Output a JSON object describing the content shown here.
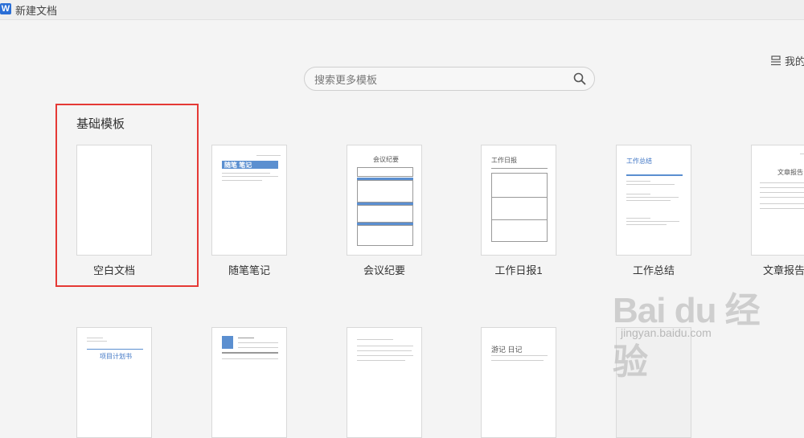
{
  "window": {
    "title": "新建文档",
    "app_icon_letter": "W"
  },
  "search": {
    "placeholder": "搜索更多模板",
    "value": ""
  },
  "my_templates": {
    "label": "我的"
  },
  "section": {
    "title": "基础模板"
  },
  "templates": [
    {
      "label": "空白文档",
      "highlighted": true
    },
    {
      "label": "随笔笔记",
      "thumb_title": "随笔 笔记"
    },
    {
      "label": "会议纪要",
      "thumb_title": "会议纪要"
    },
    {
      "label": "工作日报1",
      "thumb_title": "工作日报"
    },
    {
      "label": "工作总结",
      "thumb_title": "工作总结"
    },
    {
      "label": "文章报告",
      "thumb_title": "文章报告"
    }
  ],
  "row2": [
    {
      "thumb_title": "项目计划书"
    },
    {
      "thumb_title": ""
    },
    {
      "thumb_title": ""
    },
    {
      "thumb_title": "游记 日记"
    },
    {
      "thumb_title": ""
    }
  ],
  "watermark": {
    "main": "Bai du 经验",
    "sub": "jingyan.baidu.com"
  },
  "colors": {
    "highlight": "#e53935",
    "accent": "#5b8fd0",
    "app_icon": "#2b6fd6"
  }
}
